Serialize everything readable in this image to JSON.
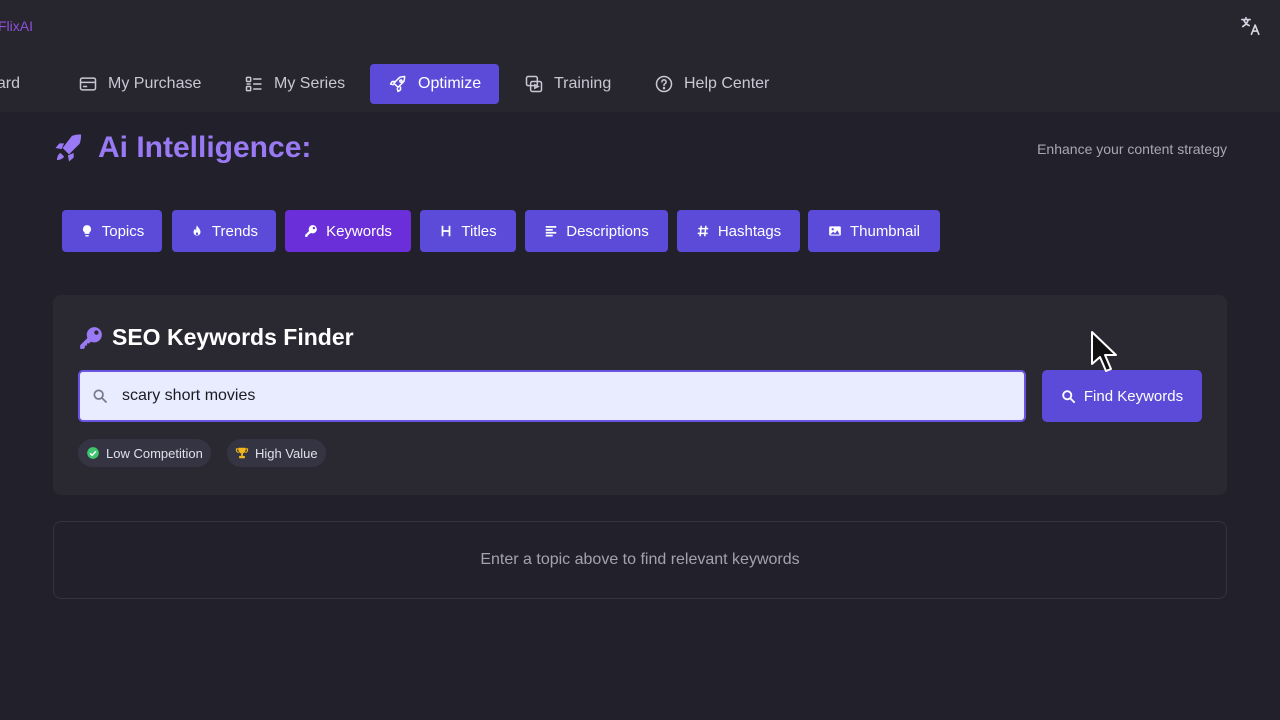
{
  "app": {
    "brand": "FlixAI"
  },
  "nav": {
    "items": [
      {
        "label": "oard",
        "icon": "dashboard-icon"
      },
      {
        "label": "My Purchase",
        "icon": "credit-card-icon"
      },
      {
        "label": "My Series",
        "icon": "list-icon"
      },
      {
        "label": "Optimize",
        "icon": "rocket-icon",
        "active": true
      },
      {
        "label": "Training",
        "icon": "training-icon"
      },
      {
        "label": "Help Center",
        "icon": "question-circle-icon"
      }
    ]
  },
  "page": {
    "title": "Ai Intelligence:",
    "tagline": "Enhance your content strategy"
  },
  "tabs": [
    {
      "label": "Topics",
      "icon": "lightbulb-icon"
    },
    {
      "label": "Trends",
      "icon": "fire-icon"
    },
    {
      "label": "Keywords",
      "icon": "key-icon",
      "active": true
    },
    {
      "label": "Titles",
      "icon": "heading-icon"
    },
    {
      "label": "Descriptions",
      "icon": "align-left-icon"
    },
    {
      "label": "Hashtags",
      "icon": "hashtag-icon"
    },
    {
      "label": "Thumbnail",
      "icon": "image-icon"
    }
  ],
  "finder": {
    "title": "SEO Keywords Finder",
    "search_value": "scary short movies",
    "button_label": "Find Keywords",
    "badges": [
      {
        "label": "Low Competition",
        "icon": "check-circle-icon"
      },
      {
        "label": "High Value",
        "icon": "trophy-icon"
      }
    ]
  },
  "results": {
    "empty_message": "Enter a topic above to find relevant keywords"
  },
  "colors": {
    "accent": "#5b4bd8",
    "accent_active": "#6a2fd8",
    "headline": "#9a7af4",
    "background": "#22212b"
  }
}
